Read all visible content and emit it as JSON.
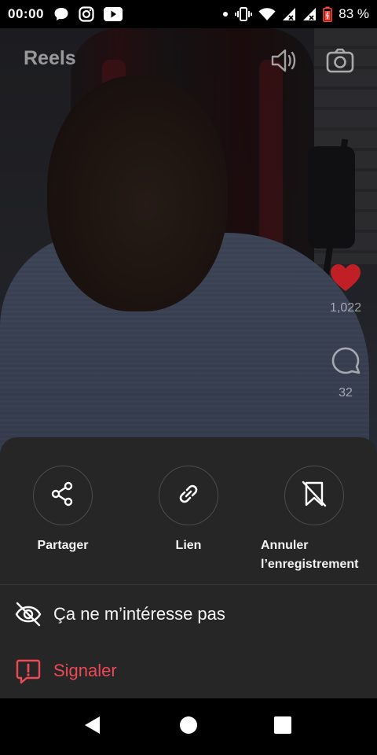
{
  "status_bar": {
    "time": "00:00",
    "battery_percent": "83 %",
    "icons": [
      "chat-bubble-icon",
      "instagram-icon",
      "youtube-icon",
      "dot-icon",
      "vibrate-icon",
      "wifi-icon",
      "signal-icon",
      "signal-icon",
      "battery-icon"
    ]
  },
  "reel": {
    "title": "Reels",
    "likes": "1,022",
    "comments": "32",
    "like_color": "#e0242f"
  },
  "sheet": {
    "actions": [
      {
        "label": "Partager",
        "icon": "share-icon"
      },
      {
        "label": "Lien",
        "icon": "link-icon"
      },
      {
        "label_line1": "Annuler",
        "label_line2": "l’enregistrement",
        "icon": "bookmark-remove-icon"
      }
    ],
    "options": [
      {
        "label": "Ça ne m’intéresse pas",
        "icon": "eye-off-icon"
      },
      {
        "label": "Signaler",
        "icon": "report-icon",
        "color": "#ed4956"
      }
    ]
  },
  "nav_bar": {
    "buttons": [
      "back-button",
      "home-button",
      "recents-button"
    ]
  }
}
